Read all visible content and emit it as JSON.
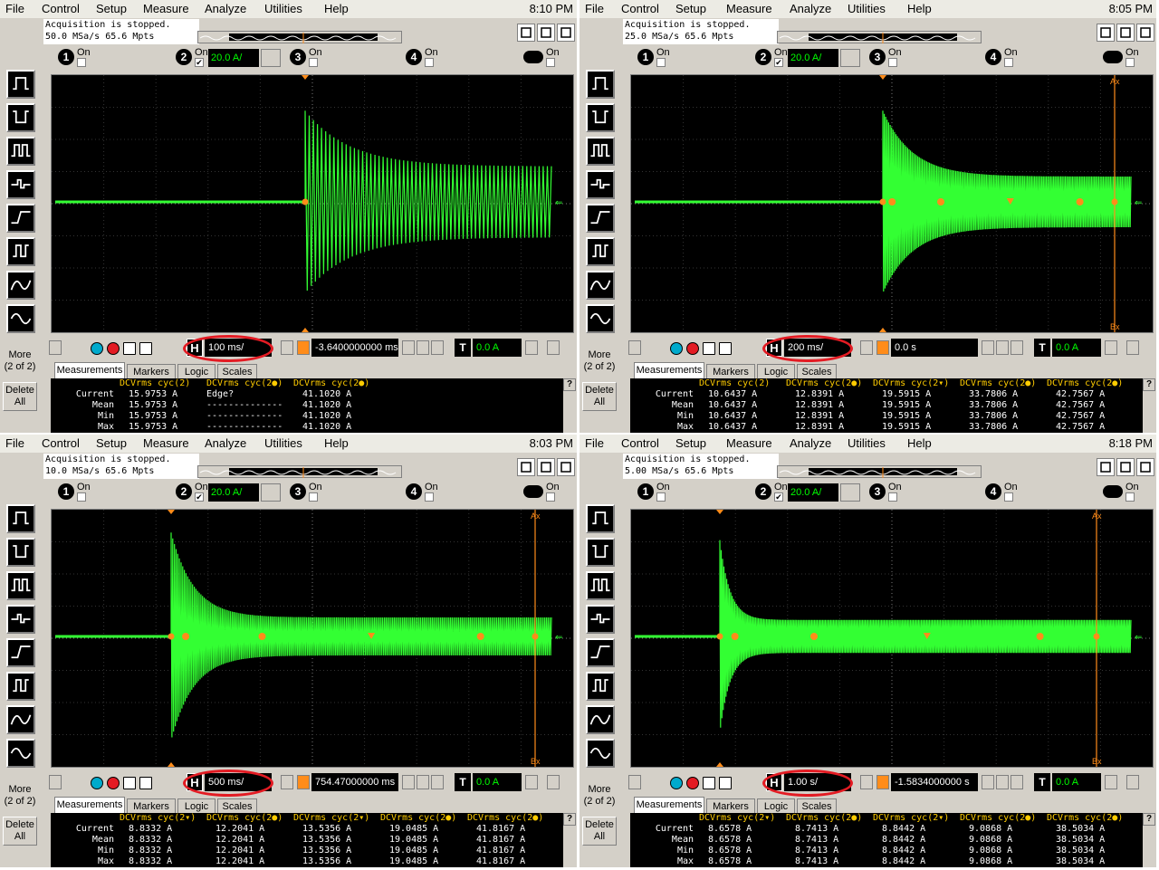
{
  "menu": [
    "File",
    "Control",
    "Setup",
    "Measure",
    "Analyze",
    "Utilities",
    "Help"
  ],
  "windows": [
    {
      "clock": "8:10 PM",
      "status_line1": "Acquisition is stopped.",
      "status_line2": "50.0 MSa/s   65.6 Mpts",
      "channel_scale": "20.0 A/",
      "timebase": "100 ms/",
      "position": "-3.6400000000 ms",
      "trigger_level": "0.0 A",
      "more_label": "More",
      "more_sub": "(2 of 2)",
      "delete_label": "Delete",
      "delete_sub": "All",
      "tabs": [
        "Measurements",
        "Markers",
        "Logic",
        "Scales"
      ],
      "meas_headers": [
        "DCVrms cyc(2)",
        "DCVrms cyc(2●)",
        "DCVrms cyc(2●)"
      ],
      "meas_rows": [
        {
          "label": "Current",
          "vals": [
            "15.9753 A",
            "Edge?",
            "41.1020 A"
          ]
        },
        {
          "label": "Mean",
          "vals": [
            "15.9753 A",
            "--------------",
            "41.1020 A"
          ]
        },
        {
          "label": "Min",
          "vals": [
            "15.9753 A",
            "--------------",
            "41.1020 A"
          ]
        },
        {
          "label": "Max",
          "vals": [
            "15.9753 A",
            "--------------",
            "41.1020 A"
          ]
        }
      ]
    },
    {
      "clock": "8:05 PM",
      "status_line1": "Acquisition is stopped.",
      "status_line2": "25.0 MSa/s   65.6 Mpts",
      "channel_scale": "20.0 A/",
      "timebase": "200 ms/",
      "position": "0.0 s",
      "trigger_level": "0.0 A",
      "more_label": "More",
      "more_sub": "(2 of 2)",
      "delete_label": "Delete",
      "delete_sub": "All",
      "tabs": [
        "Measurements",
        "Markers",
        "Logic",
        "Scales"
      ],
      "meas_headers": [
        "DCVrms cyc(2)",
        "DCVrms cyc(2●)",
        "DCVrms cyc(2▾)",
        "DCVrms cyc(2●)",
        "DCVrms cyc(2●)"
      ],
      "meas_rows": [
        {
          "label": "Current",
          "vals": [
            "10.6437 A",
            "12.8391 A",
            "19.5915 A",
            "33.7806 A",
            "42.7567 A"
          ]
        },
        {
          "label": "Mean",
          "vals": [
            "10.6437 A",
            "12.8391 A",
            "19.5915 A",
            "33.7806 A",
            "42.7567 A"
          ]
        },
        {
          "label": "Min",
          "vals": [
            "10.6437 A",
            "12.8391 A",
            "19.5915 A",
            "33.7806 A",
            "42.7567 A"
          ]
        },
        {
          "label": "Max",
          "vals": [
            "10.6437 A",
            "12.8391 A",
            "19.5915 A",
            "33.7806 A",
            "42.7567 A"
          ]
        }
      ]
    },
    {
      "clock": "8:03 PM",
      "status_line1": "Acquisition is stopped.",
      "status_line2": "10.0 MSa/s   65.6 Mpts",
      "channel_scale": "20.0 A/",
      "timebase": "500 ms/",
      "position": "754.47000000 ms",
      "trigger_level": "0.0 A",
      "more_label": "More",
      "more_sub": "(2 of 2)",
      "delete_label": "Delete",
      "delete_sub": "All",
      "tabs": [
        "Measurements",
        "Markers",
        "Logic",
        "Scales"
      ],
      "meas_headers": [
        "DCVrms cyc(2▾)",
        "DCVrms cyc(2●)",
        "DCVrms cyc(2▾)",
        "DCVrms cyc(2●)",
        "DCVrms cyc(2●)"
      ],
      "meas_rows": [
        {
          "label": "Current",
          "vals": [
            "8.8332 A",
            "12.2041 A",
            "13.5356 A",
            "19.0485 A",
            "41.8167 A"
          ]
        },
        {
          "label": "Mean",
          "vals": [
            "8.8332 A",
            "12.2041 A",
            "13.5356 A",
            "19.0485 A",
            "41.8167 A"
          ]
        },
        {
          "label": "Min",
          "vals": [
            "8.8332 A",
            "12.2041 A",
            "13.5356 A",
            "19.0485 A",
            "41.8167 A"
          ]
        },
        {
          "label": "Max",
          "vals": [
            "8.8332 A",
            "12.2041 A",
            "13.5356 A",
            "19.0485 A",
            "41.8167 A"
          ]
        }
      ]
    },
    {
      "clock": "8:18 PM",
      "status_line1": "Acquisition is stopped.",
      "status_line2": "5.00 MSa/s   65.6 Mpts",
      "channel_scale": "20.0 A/",
      "timebase": "1.00 s/",
      "position": "-1.5834000000 s",
      "trigger_level": "0.0 A",
      "more_label": "More",
      "more_sub": "(2 of 2)",
      "delete_label": "Delete",
      "delete_sub": "All",
      "tabs": [
        "Measurements",
        "Markers",
        "Logic",
        "Scales"
      ],
      "meas_headers": [
        "DCVrms cyc(2▾)",
        "DCVrms cyc(2●)",
        "DCVrms cyc(2▾)",
        "DCVrms cyc(2●)",
        "DCVrms cyc(2●)"
      ],
      "meas_rows": [
        {
          "label": "Current",
          "vals": [
            "8.6578 A",
            "8.7413 A",
            "8.8442 A",
            "9.0868 A",
            "38.5034 A"
          ]
        },
        {
          "label": "Mean",
          "vals": [
            "8.6578 A",
            "8.7413 A",
            "8.8442 A",
            "9.0868 A",
            "38.5034 A"
          ]
        },
        {
          "label": "Min",
          "vals": [
            "8.6578 A",
            "8.7413 A",
            "8.8442 A",
            "9.0868 A",
            "38.5034 A"
          ]
        },
        {
          "label": "Max",
          "vals": [
            "8.6578 A",
            "8.7413 A",
            "8.8442 A",
            "9.0868 A",
            "38.5034 A"
          ]
        }
      ]
    }
  ],
  "channel_labels": [
    "1",
    "2",
    "3",
    "4"
  ],
  "on_label": "On",
  "horizontal_label": "H",
  "trigger_label": "T",
  "marker_ax": "Ax",
  "marker_bx": "Bx",
  "colors": {
    "trace": "#33ff33",
    "marker": "#ff8c1a",
    "annotation": "#e31b23",
    "grid": "#555555",
    "screen": "#000000"
  }
}
